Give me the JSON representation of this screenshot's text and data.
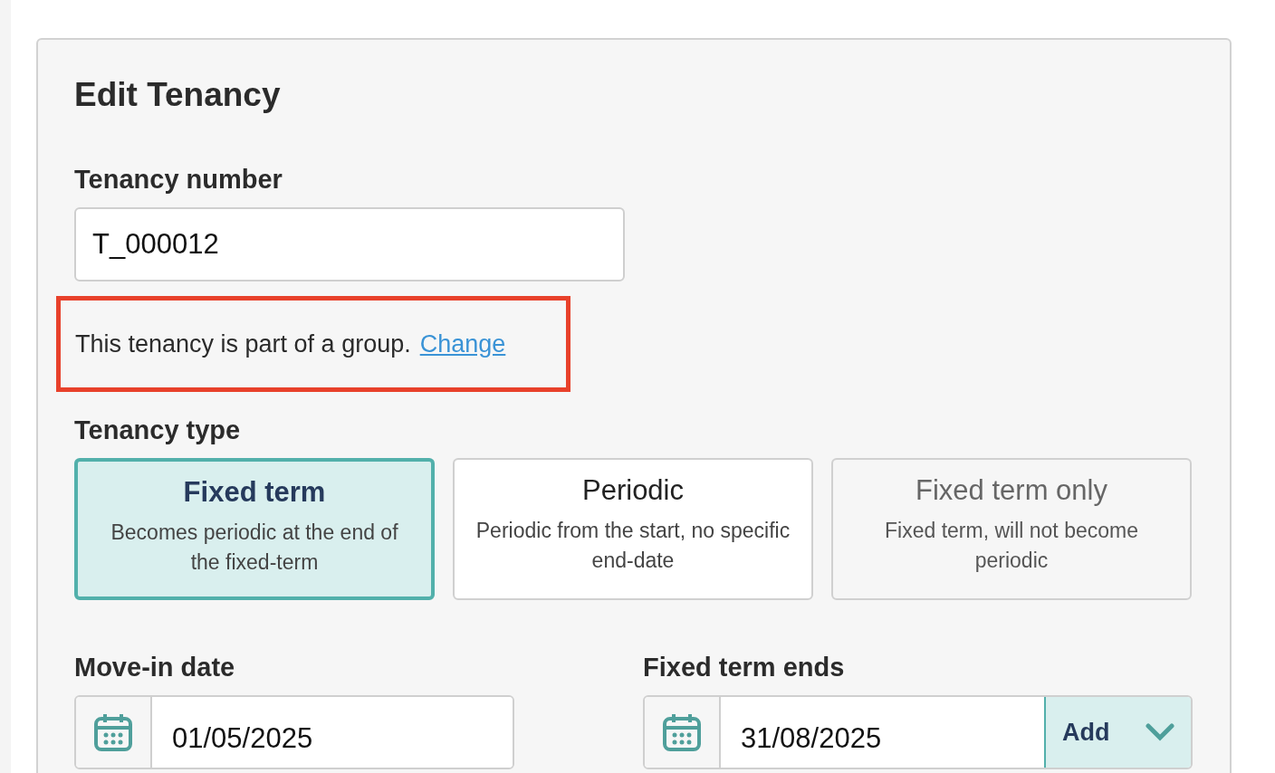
{
  "form": {
    "title": "Edit Tenancy",
    "tenancy_number": {
      "label": "Tenancy number",
      "value": "T_000012"
    },
    "group_notice": {
      "text": "This tenancy is part of a group.",
      "link": "Change",
      "highlighted": true
    },
    "tenancy_type": {
      "label": "Tenancy type",
      "options": [
        {
          "title": "Fixed term",
          "description": "Becomes periodic at the end of the fixed-term",
          "selected": true,
          "disabled": false
        },
        {
          "title": "Periodic",
          "description": "Periodic from the start, no specific end-date",
          "selected": false,
          "disabled": false
        },
        {
          "title": "Fixed term only",
          "description": "Fixed term, will not become periodic",
          "selected": false,
          "disabled": true
        }
      ]
    },
    "dates": [
      {
        "label": "Move-in date",
        "value": "01/05/2025"
      },
      {
        "label": "Fixed term ends",
        "value": "31/08/2025",
        "add_button": "Add"
      }
    ]
  }
}
